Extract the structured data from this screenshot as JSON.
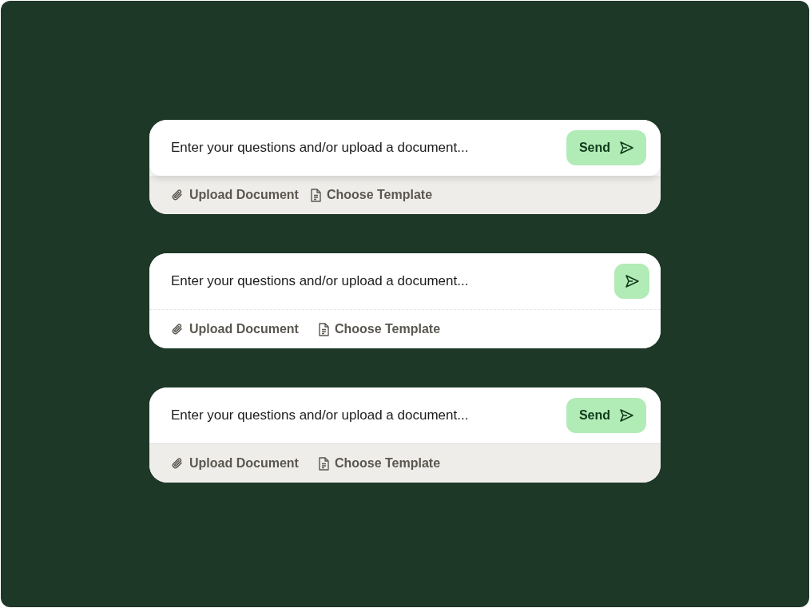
{
  "composers": [
    {
      "kind": "raised",
      "placeholder": "Enter your questions and/or upload a document...",
      "send_label": "Send",
      "actions": [
        {
          "kind": "attach",
          "label": "Upload Document"
        },
        {
          "kind": "template",
          "label": "Choose Template"
        }
      ]
    },
    {
      "kind": "divided",
      "placeholder": "Enter your questions and/or upload a document...",
      "actions": [
        {
          "kind": "attach",
          "label": "Upload Document"
        },
        {
          "kind": "template",
          "label": "Choose Template"
        }
      ]
    },
    {
      "kind": "flat",
      "placeholder": "Enter your questions and/or upload a document...",
      "send_label": "Send",
      "actions": [
        {
          "kind": "attach",
          "label": "Upload Document"
        },
        {
          "kind": "template",
          "label": "Choose Template"
        }
      ]
    }
  ]
}
